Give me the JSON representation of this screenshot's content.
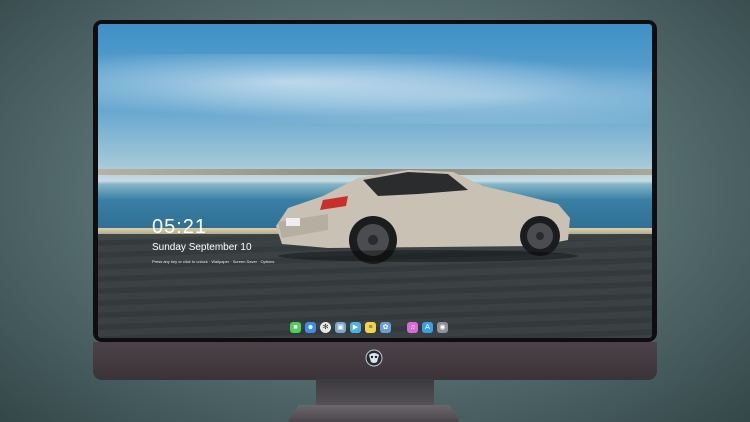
{
  "lock_screen": {
    "time": "05:21",
    "date": "Sunday September  10",
    "subtext": "Press any key or click to unlock  ·  Wallpaper  ·  Screen Saver  ·  Options"
  },
  "dock": {
    "icons": [
      "messages-icon",
      "finder-icon",
      "safari-icon",
      "preview-icon",
      "clapperboard-icon",
      "notes-icon",
      "photos-icon",
      "itunes-icon",
      "app-store-icon",
      "camera-icon"
    ]
  },
  "colors": {
    "accent": "#3f90c6",
    "bezel": "#0e0e10",
    "chin": "#4b4348"
  }
}
